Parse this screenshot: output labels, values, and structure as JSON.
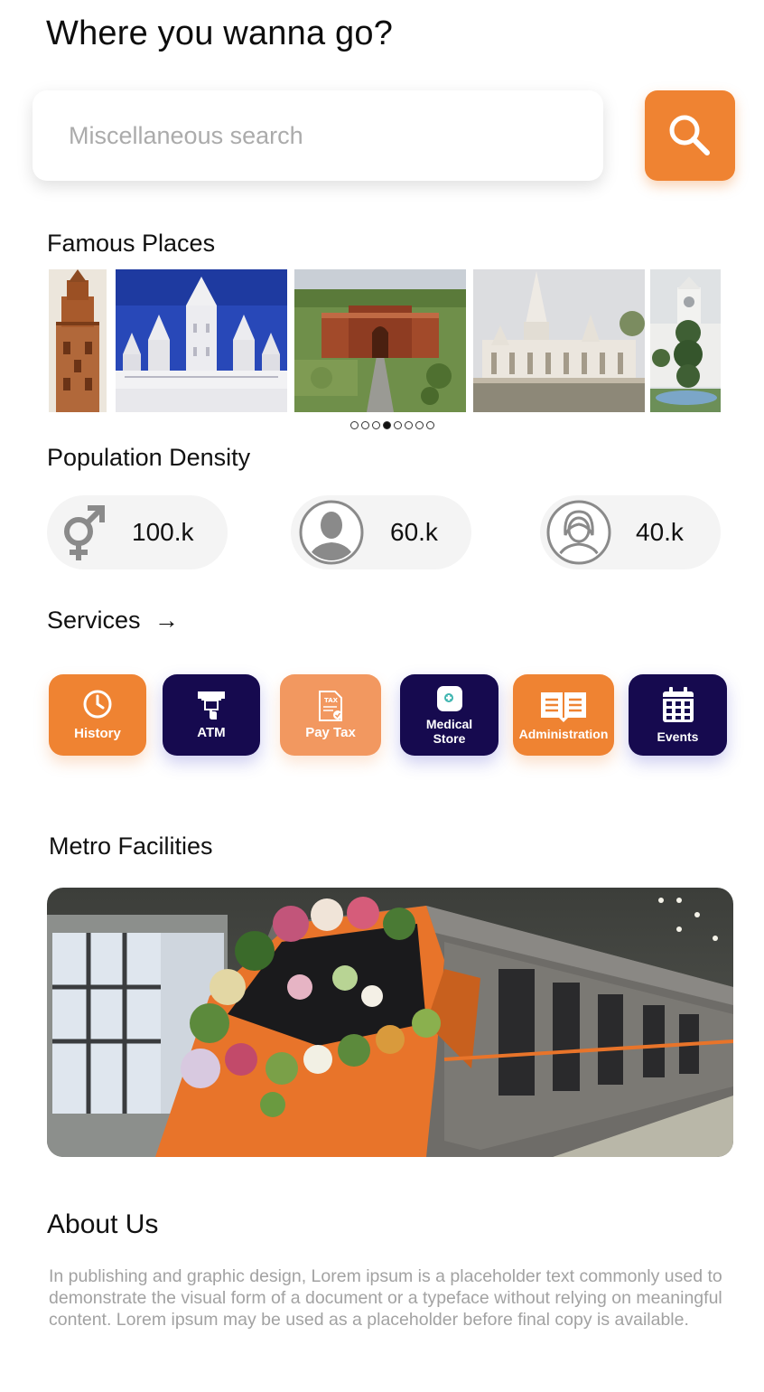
{
  "header": {
    "title": "Where you wanna go?"
  },
  "search": {
    "placeholder": "Miscellaneous search"
  },
  "famous_places": {
    "title": "Famous Places",
    "slide_count": 8,
    "active_slide_index": 3
  },
  "population": {
    "title": "Population Density",
    "items": [
      {
        "icon": "gender-icon",
        "value": "100.k"
      },
      {
        "icon": "male-avatar-icon",
        "value": "60.k"
      },
      {
        "icon": "female-avatar-icon",
        "value": "40.k"
      }
    ]
  },
  "services": {
    "title": "Services",
    "arrow": "→",
    "items": [
      {
        "label": "History",
        "icon": "clock-icon",
        "color": "#ef8332"
      },
      {
        "label": "ATM",
        "icon": "atm-icon",
        "color": "#160a4f"
      },
      {
        "label": "Pay Tax",
        "icon": "tax-document-icon",
        "color": "#f29860"
      },
      {
        "label_line1": "Medical",
        "label_line2": "Store",
        "icon": "medical-icon",
        "color": "#160a4f"
      },
      {
        "label": "Administration",
        "icon": "book-icon",
        "color": "#ef8332"
      },
      {
        "label": "Events",
        "icon": "calendar-icon",
        "color": "#160a4f"
      }
    ]
  },
  "metro": {
    "title": "Metro Facilities"
  },
  "about": {
    "title": "About Us",
    "text": "In publishing and graphic design, Lorem ipsum is a placeholder text commonly used to demonstrate the visual form of a document or a typeface without relying on meaningful content. Lorem ipsum may be used as a placeholder before final copy is available."
  },
  "colors": {
    "accent": "#ef8332",
    "navy": "#160a4f",
    "muted": "#a2a2a2"
  }
}
